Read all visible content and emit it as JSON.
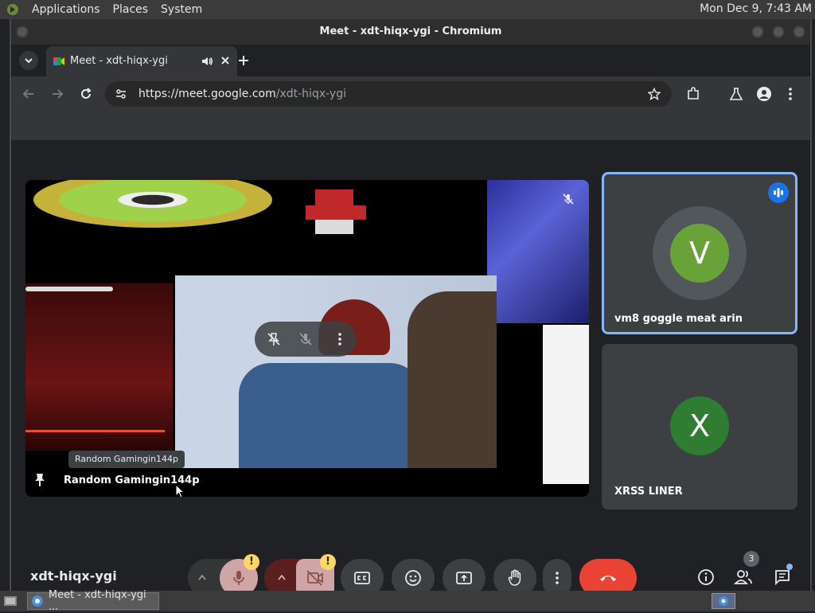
{
  "system": {
    "menu": [
      "Applications",
      "Places",
      "System"
    ],
    "clock": "Mon Dec 9, 7:43 AM"
  },
  "window": {
    "title": "Meet - xdt-hiqx-ygi - Chromium"
  },
  "browser": {
    "tab_title": "Meet - xdt-hiqx-ygi",
    "url_domain": "https://meet.google.com",
    "url_path": "/xdt-hiqx-ygi"
  },
  "meet": {
    "main_tile": {
      "tooltip": "Random Gamingin144p",
      "name": "Random Gamingin144p"
    },
    "participants": [
      {
        "name": "vm8 goggle meat arin",
        "initial": "V",
        "color": "#6aa23a"
      },
      {
        "name": "XRSS LINER",
        "initial": "X",
        "color": "#2e7d32"
      }
    ],
    "meeting_code": "xdt-hiqx-ygi",
    "people_count": "3"
  },
  "taskbar": {
    "item": "Meet - xdt-hiqx-ygi ..."
  },
  "colors": {
    "accent": "#8ab4f8",
    "end_call": "#ea4335",
    "mic_off_bg": "#cfa5a5",
    "warning": "#fdd663"
  }
}
